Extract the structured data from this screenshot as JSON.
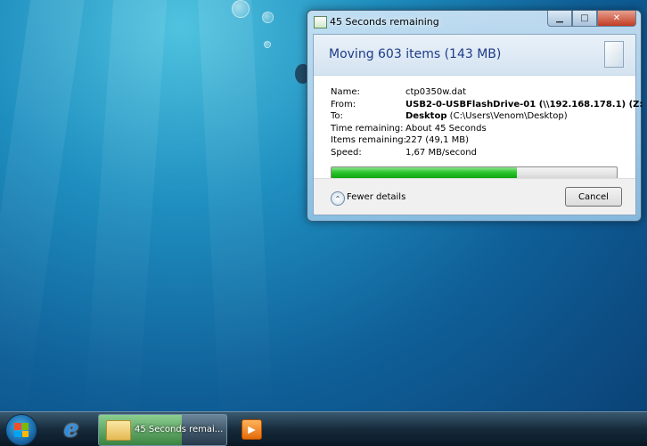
{
  "window": {
    "title": "45 Seconds remaining",
    "heading": "Moving 603 items (143 MB)"
  },
  "details": {
    "name_label": "Name:",
    "name_value": "ctp0350w.dat",
    "from_label": "From:",
    "from_value": "USB2-0-USBFlashDrive-01 (\\\\192.168.178.1) (Z:",
    "to_label": "To:",
    "to_value_bold": "Desktop",
    "to_value_path": " (C:\\Users\\Venom\\Desktop)",
    "time_label": "Time remaining:",
    "time_value": "About 45 Seconds",
    "items_label": "Items remaining:",
    "items_value": "227 (49,1 MB)",
    "speed_label": "Speed:",
    "speed_value": "1,67 MB/second"
  },
  "progress": {
    "fraction": 0.65
  },
  "footer": {
    "fewer_details": "Fewer details",
    "cancel": "Cancel"
  },
  "taskbar": {
    "task_label": "45 Seconds remai...",
    "task_progress_fraction": 0.65
  },
  "icons": {
    "window": "copy-progress-icon",
    "start": "windows-start-orb",
    "browser": "internet-explorer-icon",
    "folder": "folder-icon",
    "media": "media-player-icon",
    "chevron": "chevron-up-icon"
  },
  "colors": {
    "progress_green": "#2ec62e",
    "heading_blue": "#1f3c88"
  }
}
